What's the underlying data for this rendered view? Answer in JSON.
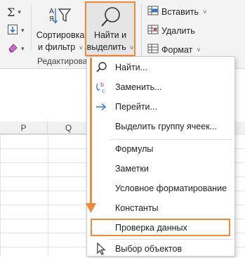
{
  "ribbon": {
    "sum_icon": "sigma-icon",
    "fill_icon": "fill-down-icon",
    "clear_icon": "eraser-icon",
    "sort_filter": {
      "line1": "Сортировка",
      "line2": "и фильтр",
      "icon": "sort-filter-icon"
    },
    "find_select": {
      "line1": "Найти и",
      "line2": "выделить",
      "icon": "magnifier-icon"
    },
    "group_label": "Редактирова",
    "cells": [
      {
        "label": "Вставить",
        "icon": "insert-cells-icon"
      },
      {
        "label": "Удалить",
        "icon": "delete-cells-icon"
      },
      {
        "label": "Формат",
        "icon": "format-cells-icon"
      }
    ]
  },
  "sheet": {
    "columns": [
      "P",
      "Q"
    ]
  },
  "menu": {
    "items": [
      {
        "label": "Найти...",
        "icon": "search-icon"
      },
      {
        "label": "Заменить...",
        "icon": "replace-icon"
      },
      {
        "label": "Перейти...",
        "icon": "arrow-right-icon"
      },
      {
        "label": "Выделить группу ячеек...",
        "icon": ""
      },
      {
        "label": "Формулы",
        "icon": ""
      },
      {
        "label": "Заметки",
        "icon": ""
      },
      {
        "label": "Условное форматирование",
        "icon": ""
      },
      {
        "label": "Константы",
        "icon": ""
      },
      {
        "label": "Проверка данных",
        "icon": ""
      },
      {
        "label": "Выбор объектов",
        "icon": "pointer-icon"
      }
    ]
  },
  "colors": {
    "accent": "#ef8a3b",
    "ribbon_bg": "#f3f3f3",
    "pressed_bg": "#e5e5e5"
  }
}
